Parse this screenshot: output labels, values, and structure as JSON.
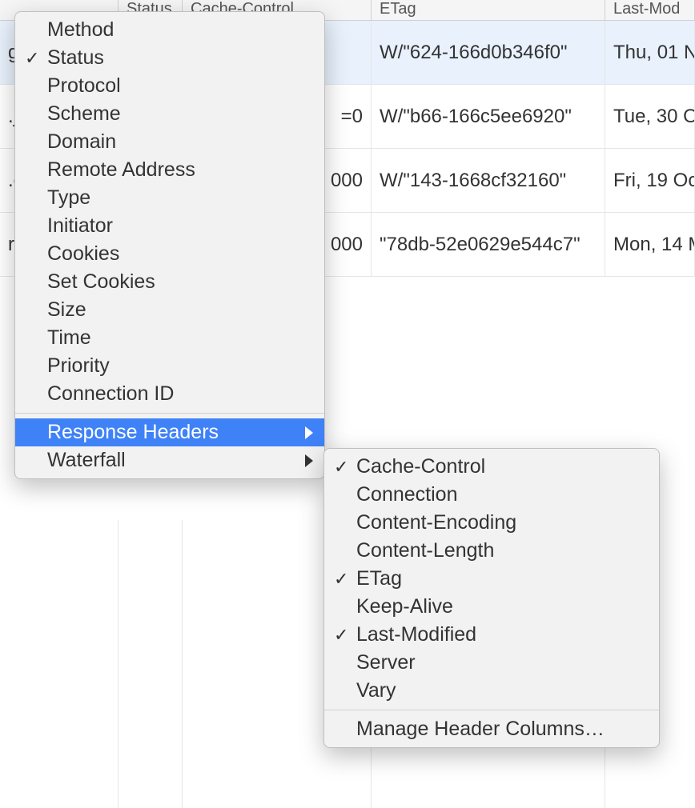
{
  "table": {
    "headers": {
      "status": "Status",
      "cacheControl": "Cache-Control",
      "etag": "ETag",
      "lastModified": "Last-Mod"
    },
    "rows": [
      {
        "name": "g",
        "cache_tail": "",
        "etag": "W/\"624-166d0b346f0\"",
        "lastmod": "Thu, 01 N"
      },
      {
        "name": ".js",
        "cache_tail": "=0",
        "etag": "W/\"b66-166c5ee6920\"",
        "lastmod": "Tue, 30 O"
      },
      {
        "name": ".c",
        "cache_tail": "000",
        "etag": "W/\"143-1668cf32160\"",
        "lastmod": "Fri, 19 Oc"
      },
      {
        "name": "rg",
        "cache_tail": "000",
        "etag": "\"78db-52e0629e544c7\"",
        "lastmod": "Mon, 14 M"
      }
    ]
  },
  "menu": {
    "items": [
      {
        "label": "Method",
        "checked": false,
        "sub": false
      },
      {
        "label": "Status",
        "checked": true,
        "sub": false
      },
      {
        "label": "Protocol",
        "checked": false,
        "sub": false
      },
      {
        "label": "Scheme",
        "checked": false,
        "sub": false
      },
      {
        "label": "Domain",
        "checked": false,
        "sub": false
      },
      {
        "label": "Remote Address",
        "checked": false,
        "sub": false
      },
      {
        "label": "Type",
        "checked": false,
        "sub": false
      },
      {
        "label": "Initiator",
        "checked": false,
        "sub": false
      },
      {
        "label": "Cookies",
        "checked": false,
        "sub": false
      },
      {
        "label": "Set Cookies",
        "checked": false,
        "sub": false
      },
      {
        "label": "Size",
        "checked": false,
        "sub": false
      },
      {
        "label": "Time",
        "checked": false,
        "sub": false
      },
      {
        "label": "Priority",
        "checked": false,
        "sub": false
      },
      {
        "label": "Connection ID",
        "checked": false,
        "sub": false
      }
    ],
    "footer": [
      {
        "label": "Response Headers",
        "selected": true,
        "sub": true
      },
      {
        "label": "Waterfall",
        "selected": false,
        "sub": true
      }
    ]
  },
  "submenu": {
    "items": [
      {
        "label": "Cache-Control",
        "checked": true
      },
      {
        "label": "Connection",
        "checked": false
      },
      {
        "label": "Content-Encoding",
        "checked": false
      },
      {
        "label": "Content-Length",
        "checked": false
      },
      {
        "label": "ETag",
        "checked": true
      },
      {
        "label": "Keep-Alive",
        "checked": false
      },
      {
        "label": "Last-Modified",
        "checked": true
      },
      {
        "label": "Server",
        "checked": false
      },
      {
        "label": "Vary",
        "checked": false
      }
    ],
    "manage": "Manage Header Columns…"
  }
}
